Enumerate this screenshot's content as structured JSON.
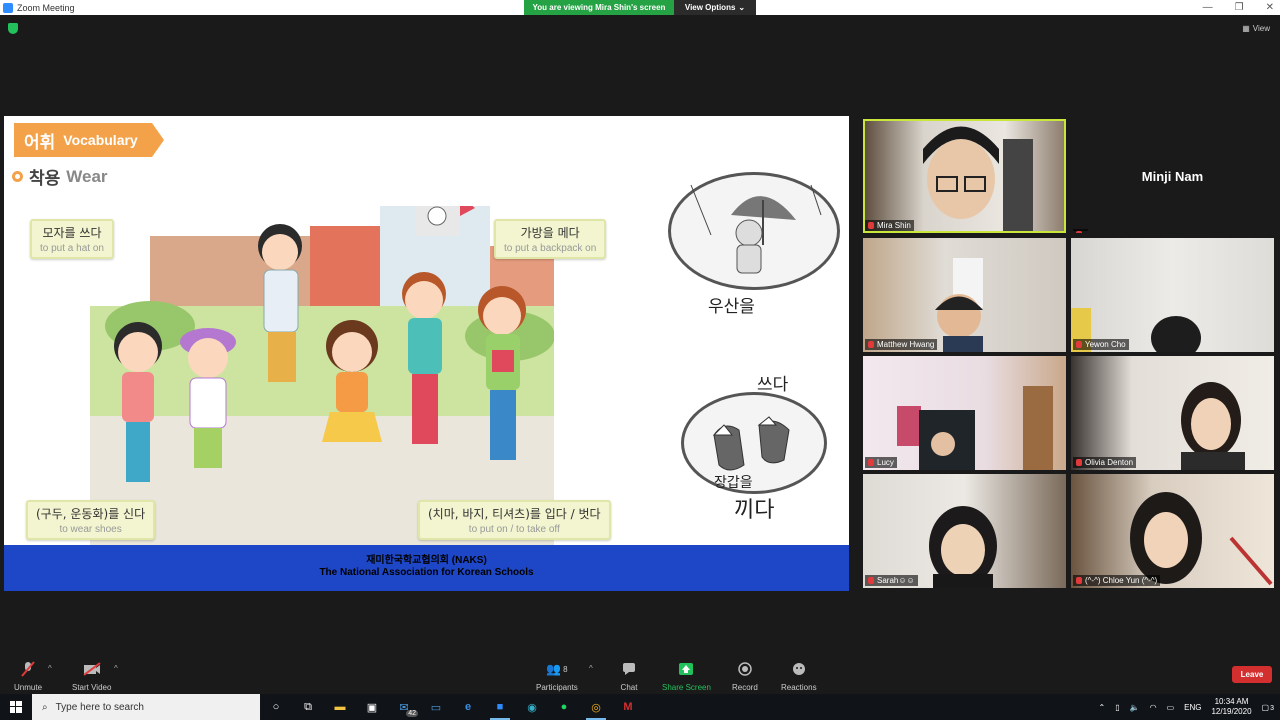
{
  "window": {
    "title": "Zoom Meeting"
  },
  "share_banner": {
    "viewing": "You are viewing Mira Shin's screen",
    "options": "View Options"
  },
  "view_button": "View",
  "slide": {
    "badge_ko": "어휘",
    "badge_en": "Vocabulary",
    "title_ko": "착용",
    "title_en": "Wear",
    "labels": [
      {
        "ko": "모자를 쓰다",
        "en": "to put a hat on"
      },
      {
        "ko": "가방을 메다",
        "en": "to put a backpack on"
      },
      {
        "ko": "(구두, 운동화)를 신다",
        "en": "to wear shoes"
      },
      {
        "ko": "(치마, 바지, 티셔츠)를 입다 / 벗다",
        "en": "to put on / to take off"
      }
    ],
    "umbrella_text": "우산을",
    "gloves_text_1": "쓰다",
    "gloves_text_2": "장갑을",
    "gloves_text_3": "끼다",
    "footer_ko": "재미한국학교협의회 (NAKS)",
    "footer_en": "The National Association for Korean Schools"
  },
  "participants_video": [
    {
      "name": "Mira Shin"
    },
    {
      "name": "Minji Nam"
    },
    {
      "name": "Matthew Hwang"
    },
    {
      "name": "Yewon Cho"
    },
    {
      "name": "Lucy"
    },
    {
      "name": "Olivia Denton"
    },
    {
      "name": "Sarah☺☺"
    },
    {
      "name": "(^-^) Chloe Yun (^-^)"
    }
  ],
  "controls": {
    "unmute": "Unmute",
    "start_video": "Start Video",
    "participants": "Participants",
    "participants_count": "8",
    "chat": "Chat",
    "share_screen": "Share Screen",
    "record": "Record",
    "reactions": "Reactions",
    "leave": "Leave"
  },
  "taskbar": {
    "search_placeholder": "Type here to search",
    "mail_badge": "42",
    "lang": "ENG",
    "time": "10:34 AM",
    "date": "12/19/2020",
    "notifications": "3"
  },
  "colors": {
    "accent_green": "#25a244",
    "leave_red": "#d32f2f",
    "active_speaker": "#c9e73b",
    "slide_footer": "#1e47c8"
  }
}
